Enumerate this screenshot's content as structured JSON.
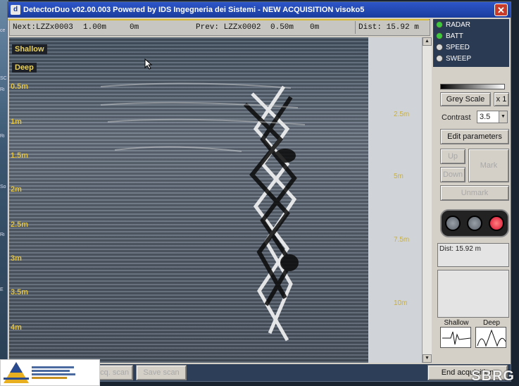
{
  "window": {
    "title": "DetectorDuo v02.00.003 Powered by IDS Ingegneria dei Sistemi - NEW ACQUISITION  visoko5",
    "app_icon_letter": "d",
    "close_label": "✕"
  },
  "status": {
    "next_label": "Next:LZZx0003",
    "next_depth": "1.00m",
    "next_pos": "0m",
    "prev_label": "Prev: LZZx0002",
    "prev_depth": "0.50m",
    "prev_pos": "0m",
    "dist": "Dist: 15.92 m"
  },
  "radargram": {
    "shallow_label": "Shallow",
    "deep_label": "Deep",
    "depth_ticks": [
      "0.5m",
      "1m",
      "1.5m",
      "2m",
      "2.5m",
      "3m",
      "3.5m",
      "4m"
    ],
    "distance_ticks": [
      "2.5m",
      "5m",
      "7.5m",
      "10m"
    ]
  },
  "panel": {
    "indicators": [
      {
        "label": "RADAR",
        "state": "on"
      },
      {
        "label": "BATT",
        "state": "on"
      },
      {
        "label": "SPEED",
        "state": "off"
      },
      {
        "label": "SWEEP",
        "state": "off"
      }
    ],
    "grey_scale_label": "Grey Scale",
    "x1_label": "x 1",
    "contrast_label": "Contrast",
    "contrast_value": "3.5",
    "edit_params_label": "Edit parameters",
    "up_label": "Up",
    "down_label": "Down",
    "mark_label": "Mark",
    "unmark_label": "Unmark",
    "dist_info": "Dist: 15.92 m",
    "shallow_wave_label": "Shallow",
    "deep_wave_label": "Deep"
  },
  "bottom": {
    "left_btn": "Acq. scan",
    "save_btn": "Save scan",
    "end_btn": "End acquisition"
  },
  "watermark": {
    "sbrg": "SBRG"
  },
  "colors": {
    "titlebar": "#1a3c9e",
    "depth_label": "#e0c040",
    "shallow_line": "#d8b830",
    "led_on": "#3ec83e",
    "light_red": "#d81030"
  }
}
